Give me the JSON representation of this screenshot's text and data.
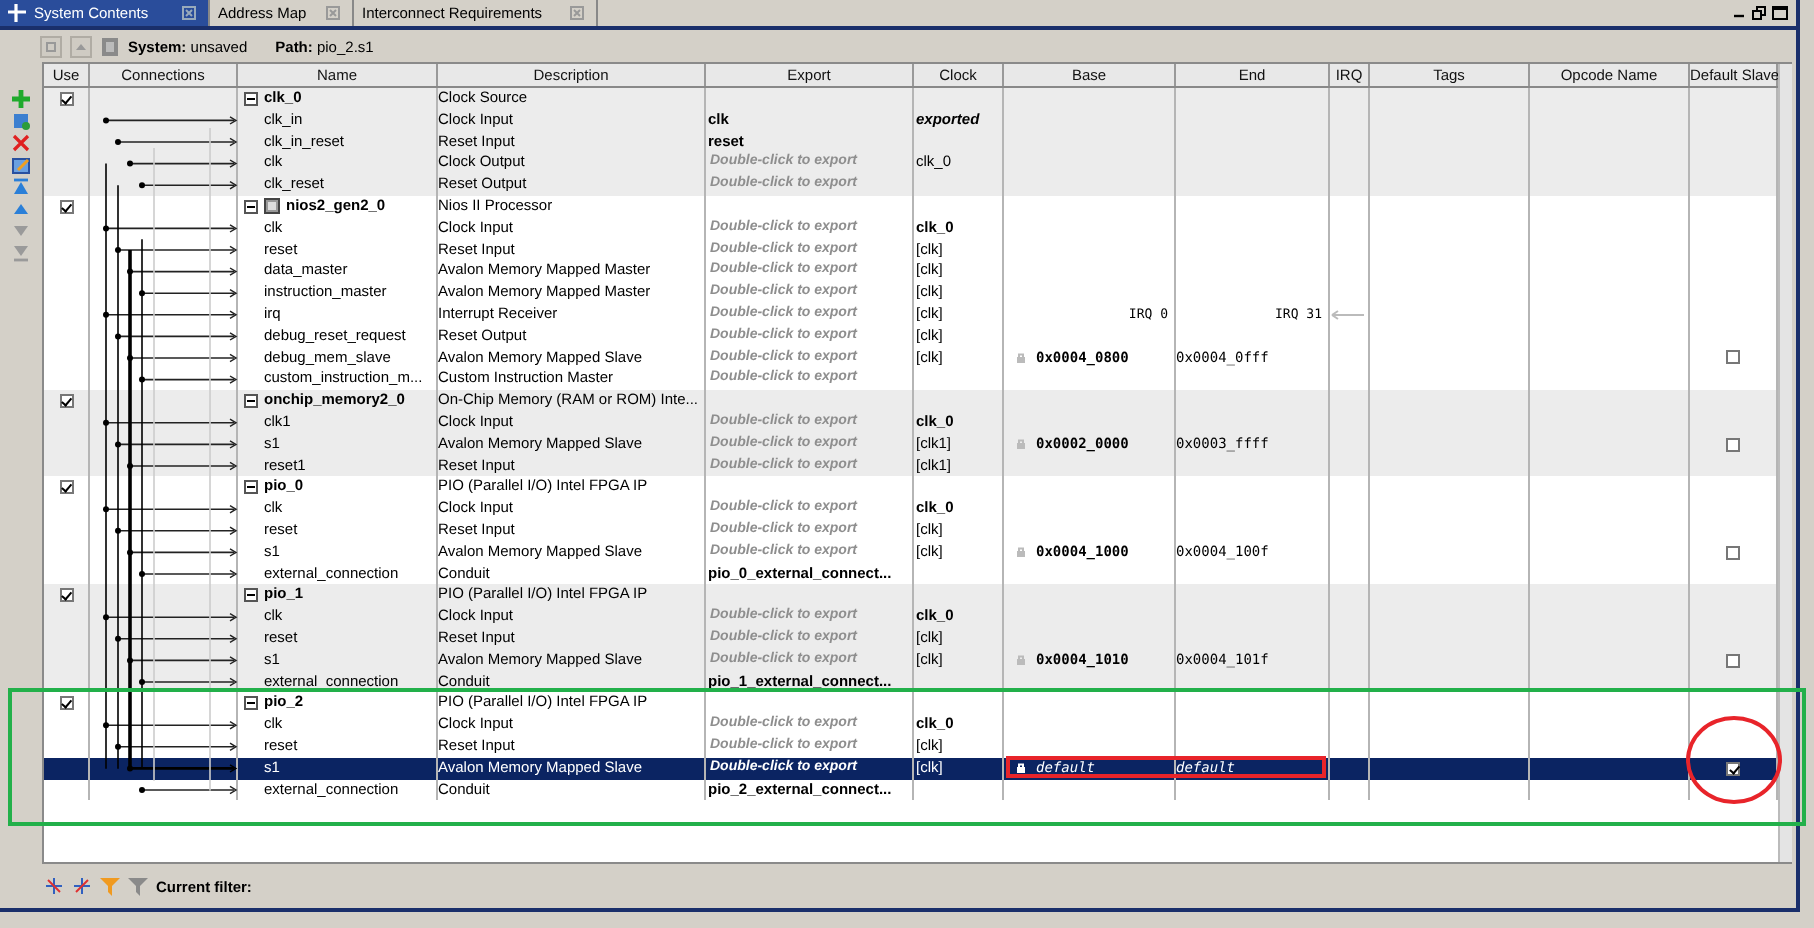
{
  "tabs": [
    {
      "label": "System Contents",
      "selected": true
    },
    {
      "label": "Address Map",
      "selected": false
    },
    {
      "label": "Interconnect Requirements",
      "selected": false
    }
  ],
  "toolbar": {
    "system": "**System:** unsaved",
    "path": "**Path:** pio_2.s1"
  },
  "table": {
    "columns": [
      "Use",
      "Connections",
      "Name",
      "Description",
      "Export",
      "Clock",
      "Base",
      "End",
      "IRQ",
      "Tags",
      "Opcode Name",
      "Default Slave"
    ],
    "components": [
      {
        "name": "clk_0",
        "description": "Clock Source",
        "use": true,
        "expanded": true,
        "ports": [
          {
            "kind": "port",
            "name": "clk_in",
            "description": "Clock Input",
            "export": {
              "text": "clk",
              "exported": true
            },
            "clock": {
              "text": "exported",
              "kind": "exported"
            },
            "selected": false
          },
          {
            "kind": "port",
            "name": "clk_in_reset",
            "description": "Reset Input",
            "export": {
              "text": "reset",
              "exported": true
            },
            "selected": false
          },
          {
            "kind": "port",
            "name": "clk",
            "description": "Clock Output",
            "export": {
              "text": "Double-click to export",
              "exported": false
            },
            "clock": {
              "text": "clk_0",
              "kind": "plain"
            },
            "selected": false
          },
          {
            "kind": "port",
            "name": "clk_reset",
            "description": "Reset Output",
            "export": {
              "text": "Double-click to export",
              "exported": false
            },
            "selected": false
          }
        ]
      },
      {
        "name": "nios2_gen2_0",
        "description": "Nios II Processor",
        "use": true,
        "expanded": true,
        "ports": [
          {
            "kind": "port",
            "name": "clk",
            "description": "Clock Input",
            "export": {
              "text": "Double-click to export",
              "exported": false
            },
            "clock": {
              "text": "clk_0",
              "kind": "connected"
            },
            "selected": false
          },
          {
            "kind": "port",
            "name": "reset",
            "description": "Reset Input",
            "export": {
              "text": "Double-click to export",
              "exported": false
            },
            "clock": {
              "text": "[clk]",
              "kind": "plain"
            },
            "selected": false
          },
          {
            "kind": "port",
            "name": "data_master",
            "description": "Avalon Memory Mapped Master",
            "export": {
              "text": "Double-click to export",
              "exported": false
            },
            "clock": {
              "text": "[clk]",
              "kind": "plain"
            },
            "selected": false
          },
          {
            "kind": "port",
            "name": "instruction_master",
            "description": "Avalon Memory Mapped Master",
            "export": {
              "text": "Double-click to export",
              "exported": false
            },
            "clock": {
              "text": "[clk]",
              "kind": "plain"
            },
            "selected": false
          },
          {
            "kind": "irq",
            "name": "irq",
            "description": "Interrupt Receiver",
            "export": {
              "text": "Double-click to export",
              "exported": false
            },
            "clock": {
              "text": "[clk]",
              "kind": "plain"
            },
            "base": "IRQ 0",
            "end": "IRQ 31",
            "selected": false
          },
          {
            "kind": "port",
            "name": "debug_reset_request",
            "description": "Reset Output",
            "export": {
              "text": "Double-click to export",
              "exported": false
            },
            "clock": {
              "text": "[clk]",
              "kind": "plain"
            },
            "selected": false
          },
          {
            "kind": "slave",
            "name": "debug_mem_slave",
            "description": "Avalon Memory Mapped Slave",
            "export": {
              "text": "Double-click to export",
              "exported": false
            },
            "clock": {
              "text": "[clk]",
              "kind": "plain"
            },
            "base": "0x0004_0800",
            "end": "0x0004_0fff",
            "default_slave": false,
            "selected": false
          },
          {
            "kind": "port",
            "name": "custom_instruction_m...",
            "description": "Custom Instruction Master",
            "export": {
              "text": "Double-click to export",
              "exported": false
            },
            "selected": false
          }
        ]
      },
      {
        "name": "onchip_memory2_0",
        "description": "On-Chip Memory (RAM or ROM) Inte...",
        "use": true,
        "expanded": true,
        "ports": [
          {
            "kind": "port",
            "name": "clk1",
            "description": "Clock Input",
            "export": {
              "text": "Double-click to export",
              "exported": false
            },
            "clock": {
              "text": "clk_0",
              "kind": "connected"
            },
            "selected": false
          },
          {
            "kind": "slave",
            "name": "s1",
            "description": "Avalon Memory Mapped Slave",
            "export": {
              "text": "Double-click to export",
              "exported": false
            },
            "clock": {
              "text": "[clk1]",
              "kind": "plain"
            },
            "base": "0x0002_0000",
            "end": "0x0003_ffff",
            "default_slave": false,
            "selected": false
          },
          {
            "kind": "port",
            "name": "reset1",
            "description": "Reset Input",
            "export": {
              "text": "Double-click to export",
              "exported": false
            },
            "clock": {
              "text": "[clk1]",
              "kind": "plain"
            },
            "selected": false
          }
        ]
      },
      {
        "name": "pio_0",
        "description": "PIO (Parallel I/O) Intel FPGA IP",
        "use": true,
        "expanded": true,
        "ports": [
          {
            "kind": "port",
            "name": "clk",
            "description": "Clock Input",
            "export": {
              "text": "Double-click to export",
              "exported": false
            },
            "clock": {
              "text": "clk_0",
              "kind": "connected"
            },
            "selected": false
          },
          {
            "kind": "port",
            "name": "reset",
            "description": "Reset Input",
            "export": {
              "text": "Double-click to export",
              "exported": false
            },
            "clock": {
              "text": "[clk]",
              "kind": "plain"
            },
            "selected": false
          },
          {
            "kind": "slave",
            "name": "s1",
            "description": "Avalon Memory Mapped Slave",
            "export": {
              "text": "Double-click to export",
              "exported": false
            },
            "clock": {
              "text": "[clk]",
              "kind": "plain"
            },
            "base": "0x0004_1000",
            "end": "0x0004_100f",
            "default_slave": false,
            "selected": false
          },
          {
            "kind": "port",
            "name": "external_connection",
            "description": "Conduit",
            "export": {
              "text": "pio_0_external_connect...",
              "exported": true
            },
            "selected": false
          }
        ]
      },
      {
        "name": "pio_1",
        "description": "PIO (Parallel I/O) Intel FPGA IP",
        "use": true,
        "expanded": true,
        "ports": [
          {
            "kind": "port",
            "name": "clk",
            "description": "Clock Input",
            "export": {
              "text": "Double-click to export",
              "exported": false
            },
            "clock": {
              "text": "clk_0",
              "kind": "connected"
            },
            "selected": false
          },
          {
            "kind": "port",
            "name": "reset",
            "description": "Reset Input",
            "export": {
              "text": "Double-click to export",
              "exported": false
            },
            "clock": {
              "text": "[clk]",
              "kind": "plain"
            },
            "selected": false
          },
          {
            "kind": "slave",
            "name": "s1",
            "description": "Avalon Memory Mapped Slave",
            "export": {
              "text": "Double-click to export",
              "exported": false
            },
            "clock": {
              "text": "[clk]",
              "kind": "plain"
            },
            "base": "0x0004_1010",
            "end": "0x0004_101f",
            "default_slave": false,
            "selected": false
          },
          {
            "kind": "port",
            "name": "external_connection",
            "description": "Conduit",
            "export": {
              "text": "pio_1_external_connect...",
              "exported": true
            },
            "selected": false
          }
        ]
      },
      {
        "name": "pio_2",
        "description": "PIO (Parallel I/O) Intel FPGA IP",
        "use": true,
        "expanded": true,
        "ports": [
          {
            "kind": "port",
            "name": "clk",
            "description": "Clock Input",
            "export": {
              "text": "Double-click to export",
              "exported": false
            },
            "clock": {
              "text": "clk_0",
              "kind": "connected"
            },
            "selected": false
          },
          {
            "kind": "port",
            "name": "reset",
            "description": "Reset Input",
            "export": {
              "text": "Double-click to export",
              "exported": false
            },
            "clock": {
              "text": "[clk]",
              "kind": "plain"
            },
            "selected": false
          },
          {
            "kind": "slave",
            "name": "s1",
            "description": "Avalon Memory Mapped Slave",
            "export": {
              "text": "Double-click to export",
              "exported": false
            },
            "clock": {
              "text": "[clk]",
              "kind": "plain"
            },
            "base": "default",
            "end": "default",
            "default_slave": true,
            "selected": true
          },
          {
            "kind": "port",
            "name": "external_connection",
            "description": "Conduit",
            "export": {
              "text": "pio_2_external_connect...",
              "exported": true
            },
            "selected": false
          }
        ]
      }
    ]
  },
  "filter_bar": {
    "label": "Current filter:"
  },
  "annotations": [
    {
      "kind": "rectangle",
      "color": "#22b04a"
    },
    {
      "kind": "rectangle",
      "color": "#e8242a"
    },
    {
      "kind": "circle",
      "color": "#e8242a"
    }
  ]
}
